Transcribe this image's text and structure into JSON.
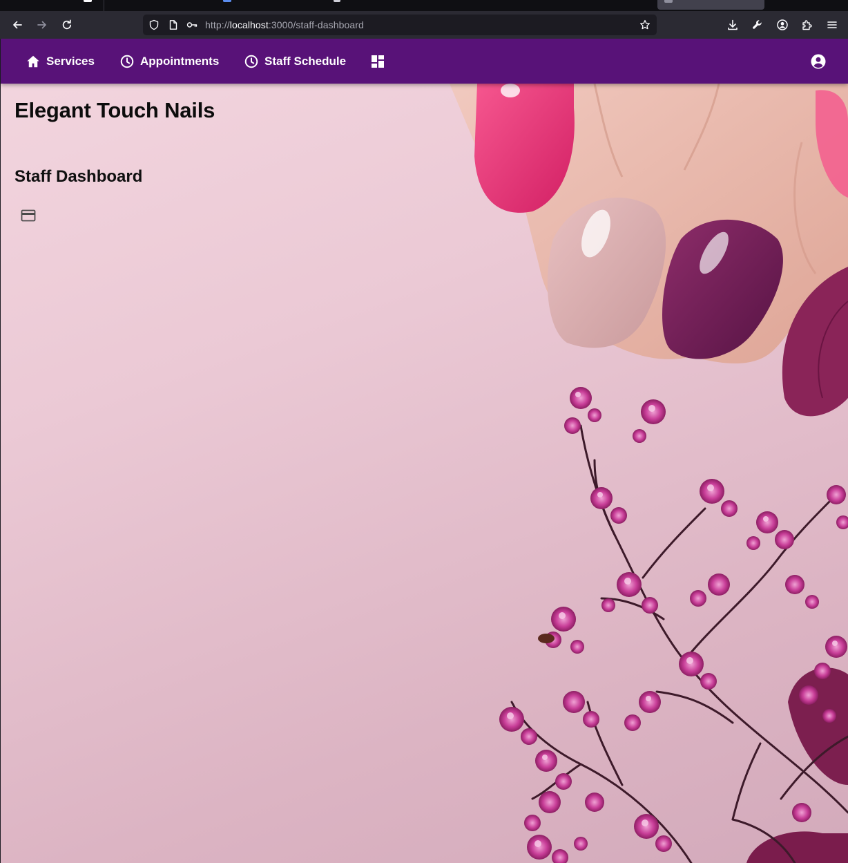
{
  "browser": {
    "url_prefix": "http://",
    "url_host": "localhost",
    "url_path": ":3000/staff-dashboard",
    "icons": [
      "back-arrow-icon",
      "forward-arrow-icon",
      "reload-icon",
      "shield-icon",
      "page-icon",
      "key-icon",
      "star-icon",
      "download-icon",
      "wrench-icon",
      "account-circle-icon",
      "extensions-icon",
      "menu-icon"
    ]
  },
  "app": {
    "colors": {
      "nav_bg": "#581278",
      "nav_text": "#ffffff",
      "page_bg": "#ebc9d5"
    },
    "nav": {
      "items": [
        {
          "label": "Services",
          "icon": "home-icon"
        },
        {
          "label": "Appointments",
          "icon": "clock-icon"
        },
        {
          "label": "Staff Schedule",
          "icon": "clock-icon"
        }
      ],
      "dashboard_icon": "dashboard-grid-icon",
      "account_icon": "account-circle-icon"
    },
    "brand_title": "Elegant Touch Nails",
    "section_title": "Staff Dashboard",
    "section_icon": "credit-card-icon",
    "background_image": "manicured hand with pink, nude and plum nails beside pink flowering branches"
  }
}
